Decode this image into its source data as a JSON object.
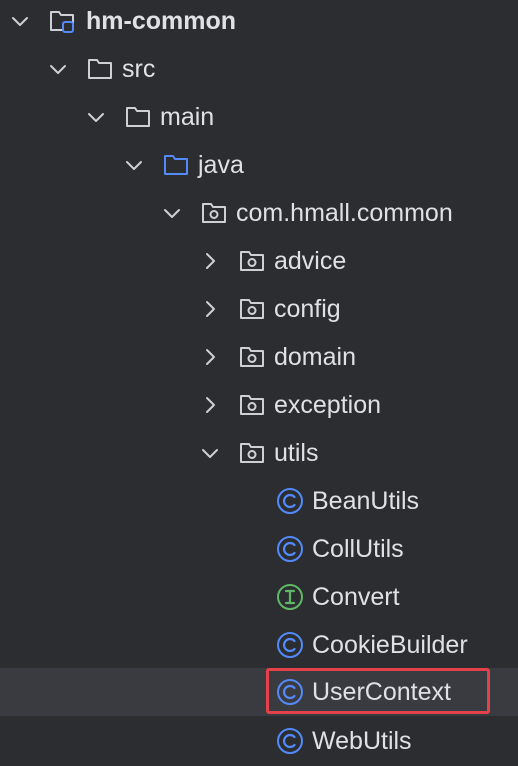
{
  "tree": {
    "items": [
      {
        "label": "hm-common",
        "icon": "module-folder-icon",
        "expanded": true
      },
      {
        "label": "src",
        "icon": "folder-icon",
        "expanded": true
      },
      {
        "label": "main",
        "icon": "folder-icon",
        "expanded": true
      },
      {
        "label": "java",
        "icon": "source-root-folder-icon",
        "expanded": true
      },
      {
        "label": "com.hmall.common",
        "icon": "package-icon",
        "expanded": true
      },
      {
        "label": "advice",
        "icon": "package-icon",
        "expanded": false
      },
      {
        "label": "config",
        "icon": "package-icon",
        "expanded": false
      },
      {
        "label": "domain",
        "icon": "package-icon",
        "expanded": false
      },
      {
        "label": "exception",
        "icon": "package-icon",
        "expanded": false
      },
      {
        "label": "utils",
        "icon": "package-icon",
        "expanded": true
      },
      {
        "label": "BeanUtils",
        "icon": "class-icon"
      },
      {
        "label": "CollUtils",
        "icon": "class-icon"
      },
      {
        "label": "Convert",
        "icon": "interface-icon"
      },
      {
        "label": "CookieBuilder",
        "icon": "class-icon"
      },
      {
        "label": "UserContext",
        "icon": "class-icon",
        "selected": true
      },
      {
        "label": "WebUtils",
        "icon": "class-icon"
      }
    ]
  },
  "colors": {
    "background": "#2b2d30",
    "selected_row": "#393b40",
    "text": "#dfe1e5",
    "icon_gray": "#ced0d6",
    "class_blue": "#548af7",
    "interface_green": "#5fb865",
    "highlight_red": "#e4414a"
  }
}
